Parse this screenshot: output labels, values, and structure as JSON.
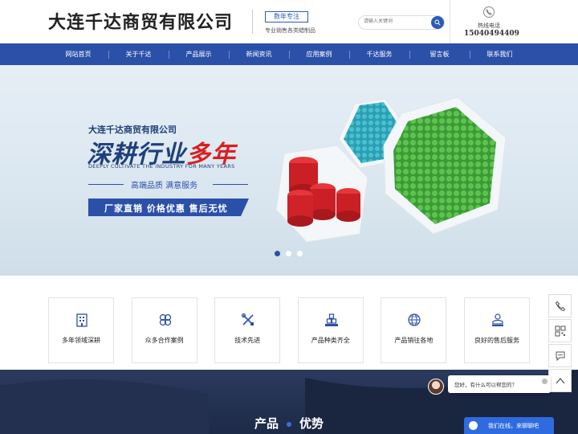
{
  "header": {
    "company_name": "大连千达商贸有限公司",
    "badge": "数年专注",
    "tagline": "专业销售各类蜡制品",
    "search_placeholder": "请输入关键词",
    "hotline_label": "热线电话",
    "hotline_number": "15040494409"
  },
  "nav": {
    "items": [
      "网站首页",
      "关于千达",
      "产品展示",
      "新闻资讯",
      "应用案例",
      "千达服务",
      "留言板",
      "联系我们"
    ]
  },
  "banner": {
    "company": "大连千达商贸有限公司",
    "headline_part1": "深耕行业",
    "headline_part2": "多年",
    "english": "DEEPLY CULTIVATE THE INDUSTRY FOR MANY YEARS",
    "subtitle": "高端品质  满意服务",
    "slogan": "厂家直销  价格优惠  售后无忧",
    "slides": 3,
    "active_slide": 1
  },
  "features": [
    {
      "label": "多年领域深耕",
      "icon": "building-icon"
    },
    {
      "label": "众多合作案例",
      "icon": "clover-icon"
    },
    {
      "label": "技术先进",
      "icon": "tools-icon"
    },
    {
      "label": "产品种类齐全",
      "icon": "boxes-icon"
    },
    {
      "label": "产品销往各地",
      "icon": "globe-icon"
    },
    {
      "label": "良好的售后服务",
      "icon": "service-icon"
    }
  ],
  "section": {
    "title_a": "产品",
    "title_b": "优势"
  },
  "chat": {
    "greeting": "您好，有什么可以帮您的？",
    "button": "我们在线，来聊聊吧"
  },
  "colors": {
    "primary": "#2b50a8",
    "accent_red": "#d9201f"
  }
}
